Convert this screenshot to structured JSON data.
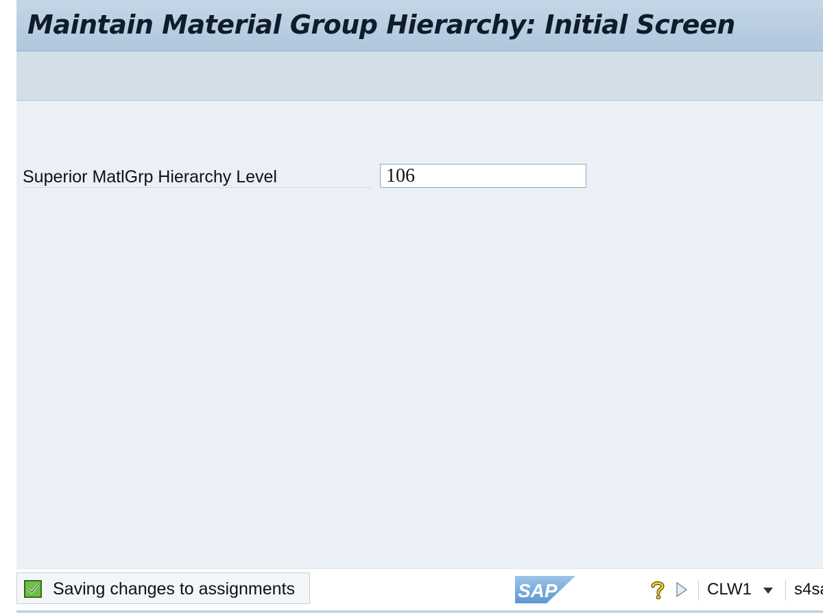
{
  "window": {
    "title": "Maintain Material Group Hierarchy: Initial Screen"
  },
  "form": {
    "field_label": "Superior MatlGrp Hierarchy Level",
    "field_value": "106"
  },
  "status_bar": {
    "message": "Saving changes to assignments",
    "message_type": "success",
    "logo_text": "SAP",
    "system_id": "CLW1",
    "server": "s4sa"
  },
  "colors": {
    "title_bar": "#afc6dc",
    "toolbar": "#d2dee8",
    "content_background": "#eaf0f6",
    "success_green": "#6fbf45",
    "sap_logo_blue": "#6aa3d8"
  },
  "icons": {
    "status": "check-icon",
    "help": "help-icon",
    "expand": "play-triangle-icon",
    "dropdown": "chevron-down-icon"
  }
}
